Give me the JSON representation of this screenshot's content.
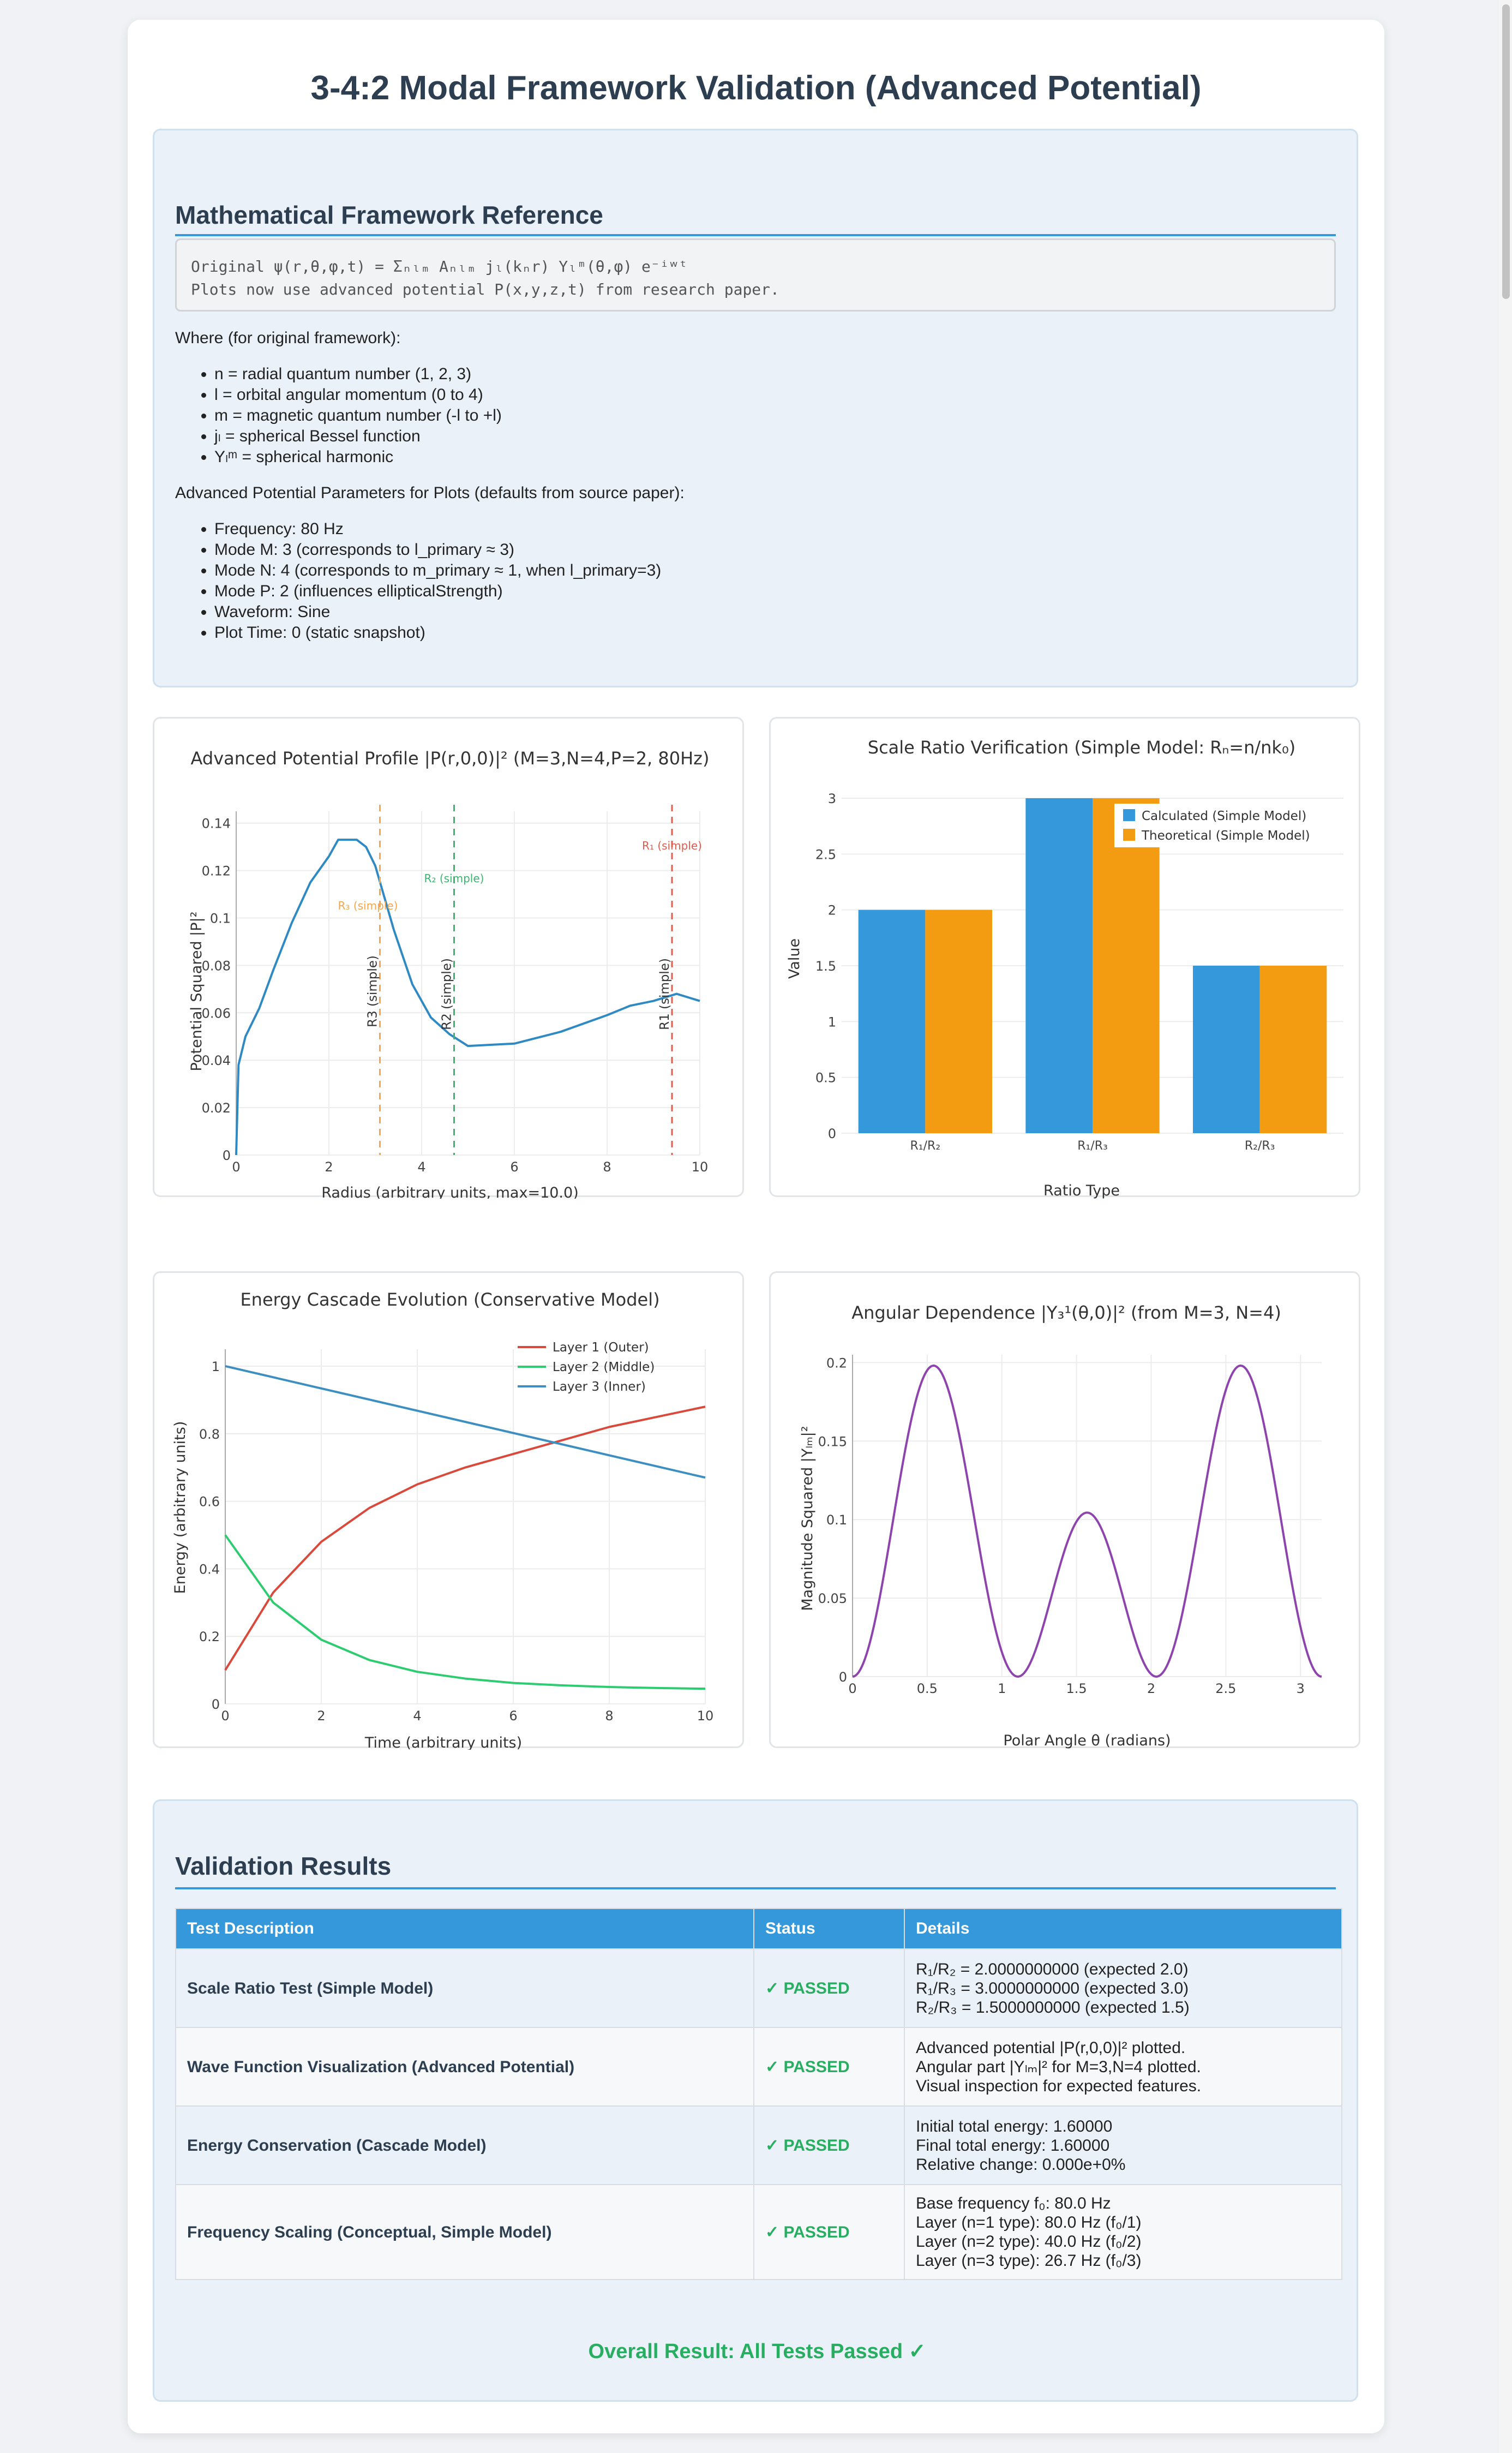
{
  "page": {
    "title": "3-4:2 Modal Framework Validation (Advanced Potential)"
  },
  "reference": {
    "heading": "Mathematical Framework Reference",
    "code_line1": "Original ψ(r,θ,φ,t) = Σₙₗₘ Aₙₗₘ jₗ(kₙr) Yₗᵐ(θ,φ) e⁻ⁱʷᵗ",
    "code_line2": "Plots now use advanced potential P(x,y,z,t) from research paper.",
    "where_label": "Where (for original framework):",
    "definitions": [
      "n = radial quantum number (1, 2, 3)",
      "l = orbital angular momentum (0 to 4)",
      "m = magnetic quantum number (-l to +l)",
      "jₗ = spherical Bessel function",
      "Yₗᵐ = spherical harmonic"
    ],
    "params_label": "Advanced Potential Parameters for Plots (defaults from source paper):",
    "params": [
      "Frequency: 80 Hz",
      "Mode M: 3 (corresponds to l_primary ≈ 3)",
      "Mode N: 4 (corresponds to m_primary ≈ 1, when l_primary=3)",
      "Mode P: 2 (influences ellipticalStrength)",
      "Waveform: Sine",
      "Plot Time: 0 (static snapshot)"
    ]
  },
  "chart_data": [
    {
      "type": "line",
      "title": "Advanced Potential Profile |P(r,0,0)|² (M=3,N=4,P=2, 80Hz)",
      "xlabel": "Radius (arbitrary units, max=10.0)",
      "ylabel": "Potential Squared |P|²",
      "xlim": [
        0,
        10
      ],
      "ylim": [
        0,
        0.145
      ],
      "xticks": [
        0,
        2,
        4,
        6,
        8,
        10
      ],
      "yticks": [
        0,
        0.02,
        0.04,
        0.06,
        0.08,
        0.1,
        0.12,
        0.14
      ],
      "x": [
        0,
        0.05,
        0.2,
        0.5,
        0.8,
        1.2,
        1.6,
        2.0,
        2.2,
        2.6,
        2.8,
        3.0,
        3.4,
        3.8,
        4.2,
        4.6,
        5.0,
        6.0,
        7.0,
        8.0,
        8.5,
        9.0,
        9.5,
        10.0
      ],
      "y": [
        0,
        0.038,
        0.05,
        0.062,
        0.078,
        0.098,
        0.115,
        0.126,
        0.133,
        0.133,
        0.13,
        0.122,
        0.095,
        0.072,
        0.058,
        0.051,
        0.046,
        0.047,
        0.052,
        0.059,
        0.063,
        0.065,
        0.068,
        0.065
      ],
      "color": "#2f8ac4",
      "annotations": [
        {
          "x": 3.1,
          "label": "R3 (simple)",
          "top_label": "R₃ (simple)",
          "color": "#f5a54a"
        },
        {
          "x": 4.7,
          "label": "R2 (simple)",
          "top_label": "R₂ (simple)",
          "color": "#3cb371"
        },
        {
          "x": 9.4,
          "label": "R1 (simple)",
          "top_label": "R₁ (simple)",
          "color": "#e05c4c"
        }
      ]
    },
    {
      "type": "bar",
      "title": "Scale Ratio Verification (Simple Model: Rₙ=n/nk₀)",
      "xlabel": "Ratio Type",
      "ylabel": "Value",
      "categories": [
        "R₁/R₂",
        "R₁/R₃",
        "R₂/R₃"
      ],
      "ylim": [
        0,
        3
      ],
      "yticks": [
        0,
        0.5,
        1,
        1.5,
        2,
        2.5,
        3
      ],
      "legend": "top-right",
      "series": [
        {
          "name": "Calculated (Simple Model)",
          "values": [
            2,
            3,
            1.5
          ],
          "color": "#3498db"
        },
        {
          "name": "Theoretical (Simple Model)",
          "values": [
            2,
            3,
            1.5
          ],
          "color": "#f39c12"
        }
      ]
    },
    {
      "type": "line",
      "title": "Energy Cascade Evolution (Conservative Model)",
      "xlabel": "Time (arbitrary units)",
      "ylabel": "Energy (arbitrary units)",
      "xlim": [
        0,
        10
      ],
      "ylim": [
        0,
        1.05
      ],
      "xticks": [
        0,
        2,
        4,
        6,
        8,
        10
      ],
      "yticks": [
        0,
        0.2,
        0.4,
        0.6,
        0.8,
        1
      ],
      "legend": "top-right",
      "series": [
        {
          "name": "Layer 1 (Outer)",
          "color": "#d94a3d",
          "x": [
            0,
            1,
            2,
            3,
            4,
            5,
            6,
            7,
            8,
            9,
            10
          ],
          "y": [
            0.1,
            0.33,
            0.48,
            0.58,
            0.65,
            0.7,
            0.74,
            0.78,
            0.82,
            0.85,
            0.88
          ]
        },
        {
          "name": "Layer 2 (Middle)",
          "color": "#2ecc71",
          "x": [
            0,
            1,
            2,
            3,
            4,
            5,
            6,
            7,
            8,
            9,
            10
          ],
          "y": [
            0.5,
            0.3,
            0.19,
            0.13,
            0.095,
            0.075,
            0.062,
            0.055,
            0.05,
            0.047,
            0.045
          ]
        },
        {
          "name": "Layer 3 (Inner)",
          "color": "#3d8fc2",
          "x": [
            0,
            10
          ],
          "y": [
            1.0,
            0.67
          ]
        }
      ]
    },
    {
      "type": "line",
      "title": "Angular Dependence |Y₃¹(θ,0)|² (from M=3, N=4)",
      "xlabel": "Polar Angle θ (radians)",
      "ylabel": "Magnitude Squared |Yₗₘ|²",
      "xlim": [
        0,
        3.1416
      ],
      "ylim": [
        0,
        0.205
      ],
      "xticks": [
        0,
        0.5,
        1,
        1.5,
        2,
        2.5,
        3
      ],
      "yticks": [
        0,
        0.05,
        0.1,
        0.15,
        0.2
      ],
      "color": "#8e44ad",
      "function": "|Y_3^1(θ,0)|^2"
    }
  ],
  "chart_labels": {
    "c1_title": "Advanced Potential Profile |P(r,0,0)|² (M=3,N=4,P=2, 80Hz)",
    "c1_xlabel": "Radius (arbitrary units, max=10.0)",
    "c1_ylabel": "Potential Squared |P|²",
    "c2_title": "Scale Ratio Verification (Simple Model: Rₙ=n/nk₀)",
    "c2_xlabel": "Ratio Type",
    "c2_ylabel": "Value",
    "c3_title": "Energy Cascade Evolution (Conservative Model)",
    "c3_xlabel": "Time (arbitrary units)",
    "c3_ylabel": "Energy (arbitrary units)",
    "c4_title": "Angular Dependence |Y₃¹(θ,0)|² (from M=3, N=4)",
    "c4_xlabel": "Polar Angle θ (radians)",
    "c4_ylabel": "Magnitude Squared |Yₗₘ|²"
  },
  "results": {
    "heading": "Validation Results",
    "columns": [
      "Test Description",
      "Status",
      "Details"
    ],
    "rows": [
      {
        "name": "Scale Ratio Test (Simple Model)",
        "status": "✓ PASSED",
        "details": [
          "R₁/R₂ = 2.0000000000 (expected 2.0)",
          "R₁/R₃ = 3.0000000000 (expected 3.0)",
          "R₂/R₃ = 1.5000000000 (expected 1.5)"
        ]
      },
      {
        "name": "Wave Function Visualization (Advanced Potential)",
        "status": "✓ PASSED",
        "details": [
          "Advanced potential |P(r,0,0)|² plotted.",
          "Angular part |Yₗₘ|² for M=3,N=4 plotted.",
          "Visual inspection for expected features."
        ]
      },
      {
        "name": "Energy Conservation (Cascade Model)",
        "status": "✓ PASSED",
        "details": [
          "Initial total energy: 1.60000",
          "Final total energy: 1.60000",
          "Relative change: 0.000e+0%"
        ]
      },
      {
        "name": "Frequency Scaling (Conceptual, Simple Model)",
        "status": "✓ PASSED",
        "details": [
          "Base frequency f₀: 80.0 Hz",
          "Layer (n=1 type): 80.0 Hz (f₀/1)",
          "Layer (n=2 type): 40.0 Hz (f₀/2)",
          "Layer (n=3 type): 26.7 Hz (f₀/3)"
        ]
      }
    ],
    "overall": "Overall Result: All Tests Passed ✓"
  },
  "colors": {
    "accent": "#3498db",
    "pass": "#27ae60",
    "heading": "#2c3e50"
  }
}
